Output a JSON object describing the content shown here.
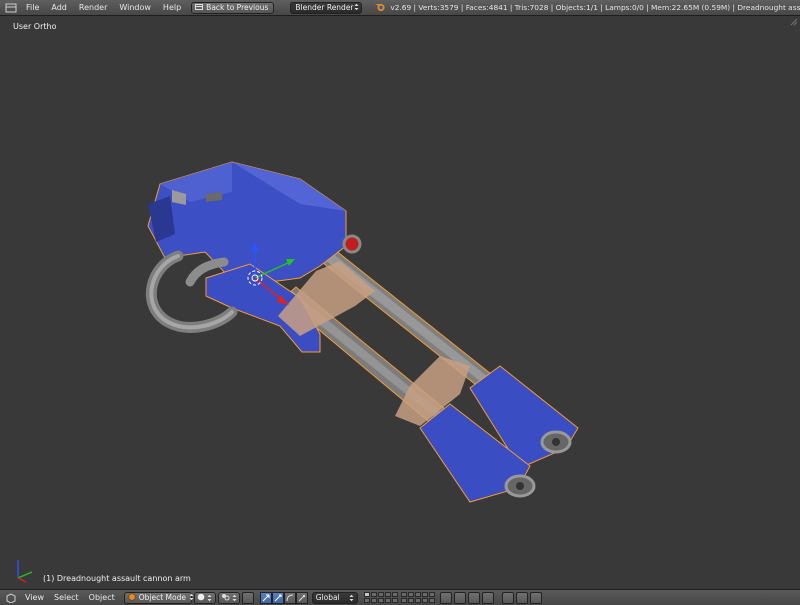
{
  "topbar": {
    "menu": [
      "File",
      "Add",
      "Render",
      "Window",
      "Help"
    ],
    "back_button": "Back to Previous",
    "render_engine": "Blender Render",
    "stats": "v2.69 | Verts:3579 | Faces:4841 | Tris:7028 | Objects:1/1 | Lamps:0/0 | Mem:22.65M (0.59M) | Dreadnought assault cannon arm"
  },
  "viewport": {
    "view_label": "User Ortho",
    "object_label": "(1) Dreadnought assault cannon arm"
  },
  "bottombar": {
    "menu": [
      "View",
      "Select",
      "Object"
    ],
    "mode": "Object Mode",
    "orientation": "Global"
  },
  "icons": {
    "editor": "3d-view-editor-icon",
    "blender_logo": "blender-logo-icon",
    "mode": "object-mode-cube-icon"
  },
  "colors": {
    "viewport_bg": "#393939",
    "model_blue": "#3d4fc4",
    "barrel_grey": "#8a8a8a",
    "band_tan": "#c8a084",
    "selection_orange": "#f39c33",
    "active_tool_blue": "#5680c2"
  }
}
